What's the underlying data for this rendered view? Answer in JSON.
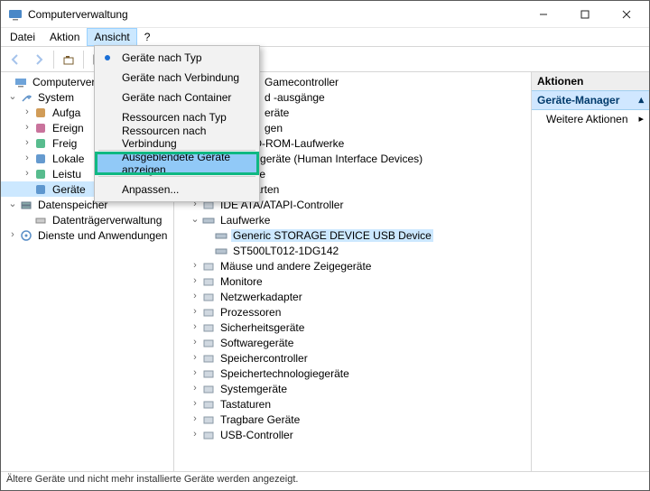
{
  "window": {
    "title": "Computerverwaltung"
  },
  "menu": {
    "file": "Datei",
    "action": "Aktion",
    "view": "Ansicht",
    "help": "?"
  },
  "dropdown": {
    "dev_by_type": "Geräte nach Typ",
    "dev_by_conn": "Geräte nach Verbindung",
    "dev_by_cont": "Geräte nach Container",
    "res_by_type": "Ressourcen nach Typ",
    "res_by_conn": "Ressourcen nach Verbindung",
    "show_hidden": "Ausgeblendete Geräte anzeigen",
    "customize": "Anpassen..."
  },
  "left_tree": {
    "root": "Computerver",
    "system": "System",
    "sys_children": [
      "Aufga",
      "Ereign",
      "Freig",
      "Lokale",
      "Leistu",
      "Geräte"
    ],
    "storage": "Datenspeicher",
    "storage_child": "Datenträgerverwaltung",
    "services": "Dienste und Anwendungen"
  },
  "mid_tree": {
    "partial": [
      "Gamecontroller",
      "d -ausgänge",
      "eräte",
      "gen"
    ],
    "items": [
      "DVD/CD-ROM-Laufwerke",
      "Eingabegeräte (Human Interface Devices)",
      "Firmware",
      "Grafikkarten",
      "IDE ATA/ATAPI-Controller"
    ],
    "drives_label": "Laufwerke",
    "drive_sel": "Generic STORAGE DEVICE USB Device",
    "drive2": "ST500LT012-1DG142",
    "items2": [
      "Mäuse und andere Zeigegeräte",
      "Monitore",
      "Netzwerkadapter",
      "Prozessoren",
      "Sicherheitsgeräte",
      "Softwaregeräte",
      "Speichercontroller",
      "Speichertechnologiegeräte",
      "Systemgeräte",
      "Tastaturen",
      "Tragbare Geräte",
      "USB-Controller"
    ]
  },
  "actions": {
    "header": "Aktionen",
    "sub": "Geräte-Manager",
    "more": "Weitere Aktionen"
  },
  "status": "Ältere Geräte und nicht mehr installierte Geräte werden angezeigt."
}
